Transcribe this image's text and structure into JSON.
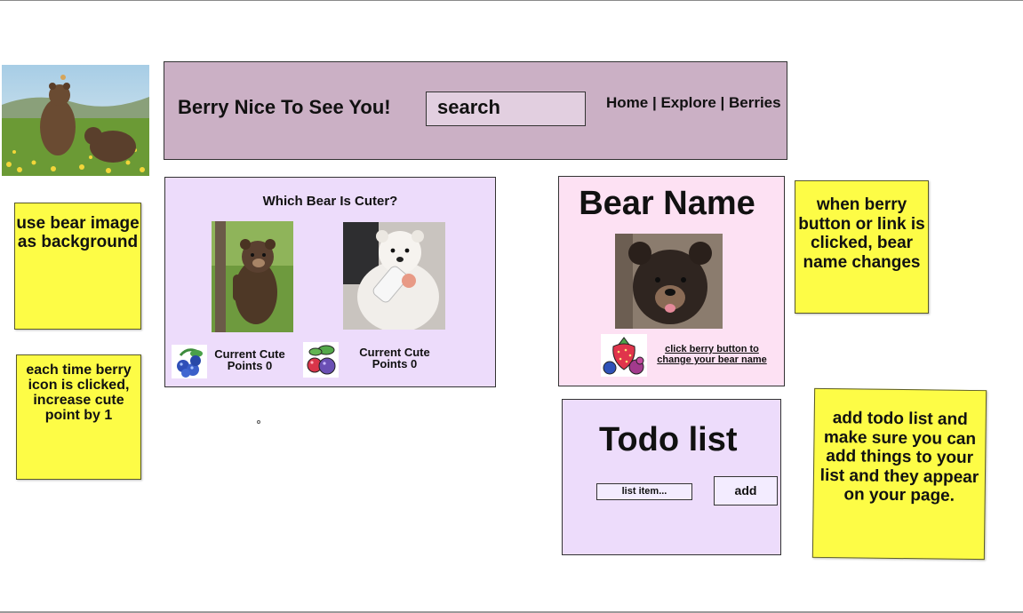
{
  "header": {
    "title": "Berry Nice To See You!",
    "search_label": "search",
    "nav": {
      "home": "Home",
      "sep1": " | ",
      "explore": "Explore",
      "sep2": " | ",
      "berries": "Berries"
    }
  },
  "cute_card": {
    "title": "Which Bear Is Cuter?",
    "left_points": "Current Cute Points 0",
    "right_points": "Current Cute Points 0"
  },
  "name_card": {
    "title": "Bear Name",
    "link": "click berry button to change your bear name"
  },
  "todo": {
    "title": "Todo list",
    "placeholder": "list item...",
    "add_label": "add"
  },
  "stickies": {
    "background_note": "use bear image as background",
    "cute_note": "each time berry icon is clicked, increase cute point by 1",
    "name_note": "when berry button or link is clicked, bear name changes",
    "todo_note": "add todo list and make sure you can add things to your list and they appear on your page."
  },
  "colors": {
    "header_bg": "#cbb0c5",
    "card_lavender": "#eddcfb",
    "card_pink": "#fde1f3",
    "sticky_yellow": "#fdfc46"
  },
  "icons": [
    "bear-photo",
    "blueberry-icon",
    "mixed-berry-icon",
    "strawberry-berry-icon"
  ]
}
